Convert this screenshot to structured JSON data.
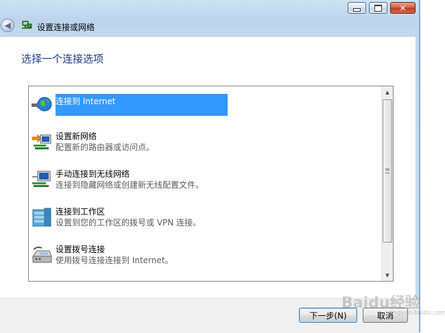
{
  "window": {
    "title": "设置连接或网络",
    "controls": {
      "minimize": "minimize",
      "maximize": "maximize",
      "close": "✕"
    }
  },
  "main": {
    "heading": "选择一个连接选项",
    "options": [
      {
        "title": "连接到 Internet",
        "description": "",
        "icon": "globe-icon",
        "selected": true
      },
      {
        "title": "设置新网络",
        "description": "配置新的路由器或访问点。",
        "icon": "new-network-icon",
        "selected": false
      },
      {
        "title": "手动连接到无线网络",
        "description": "连接到隐藏网络或创建新无线配置文件。",
        "icon": "wireless-icon",
        "selected": false
      },
      {
        "title": "连接到工作区",
        "description": "设置到您的工作区的拨号或 VPN 连接。",
        "icon": "workplace-icon",
        "selected": false
      },
      {
        "title": "设置拨号连接",
        "description": "使用拨号连接连接到 Internet。",
        "icon": "dialup-icon",
        "selected": false
      }
    ]
  },
  "footer": {
    "next_label": "下一步(N)",
    "cancel_label": "取消"
  },
  "watermark": {
    "text": "Baidu经验",
    "subtext": "jingyan.baidu.com"
  },
  "colors": {
    "selection": "#3399ff",
    "heading": "#1e3a8a",
    "frame": "#c3d9ef"
  }
}
